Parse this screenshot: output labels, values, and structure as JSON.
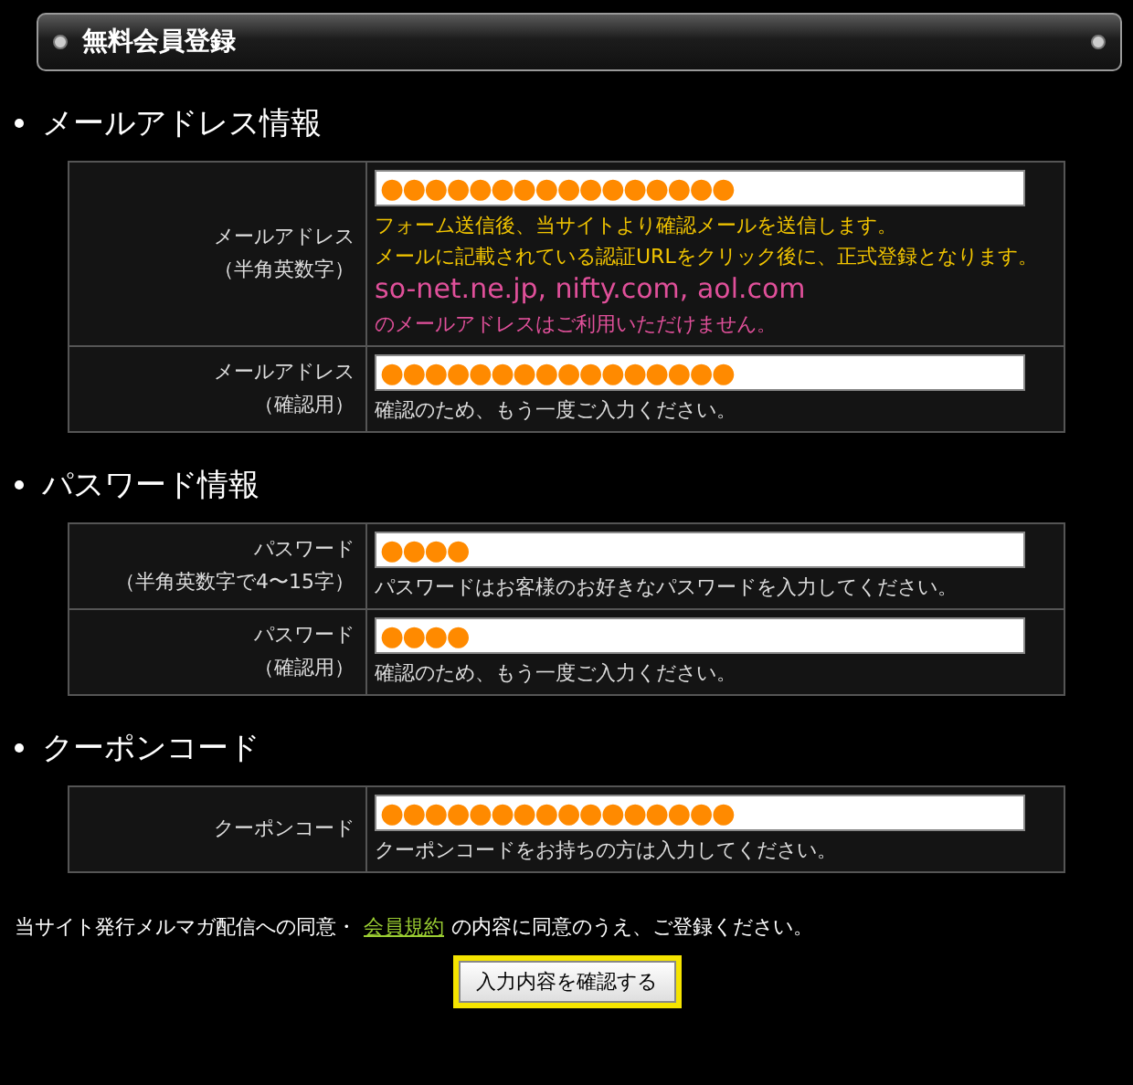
{
  "title": "無料会員登録",
  "sections": [
    {
      "heading": "メールアドレス情報",
      "rows": [
        {
          "label": "メールアドレス",
          "sublabel": "（半角英数字）",
          "value": "●●●●●●●●●●●●●●●●",
          "notes": [
            {
              "kind": "info",
              "text": "フォーム送信後、当サイトより確認メールを送信します。"
            },
            {
              "kind": "info",
              "text": "メールに記載されている認証URLをクリック後に、正式登録となります。"
            },
            {
              "kind": "warning-large",
              "text": "so-net.ne.jp, nifty.com, aol.com"
            },
            {
              "kind": "warning",
              "text": "のメールアドレスはご利用いただけません。"
            }
          ]
        },
        {
          "label": "メールアドレス",
          "sublabel": "（確認用）",
          "value": "●●●●●●●●●●●●●●●●",
          "notes": [
            {
              "kind": "plain",
              "text": "確認のため、もう一度ご入力ください。"
            }
          ]
        }
      ]
    },
    {
      "heading": "パスワード情報",
      "rows": [
        {
          "label": "パスワード",
          "sublabel": "（半角英数字で4〜15字）",
          "value": "●●●●",
          "notes": [
            {
              "kind": "plain",
              "text": "パスワードはお客様のお好きなパスワードを入力してください。"
            }
          ]
        },
        {
          "label": "パスワード",
          "sublabel": "（確認用）",
          "value": "●●●●",
          "notes": [
            {
              "kind": "plain",
              "text": "確認のため、もう一度ご入力ください。"
            }
          ]
        }
      ]
    },
    {
      "heading": "クーポンコード",
      "rows": [
        {
          "label": "クーポンコード",
          "value": "●●●●●●●●●●●●●●●●",
          "notes": [
            {
              "kind": "plain",
              "text": "クーポンコードをお持ちの方は入力してください。"
            }
          ]
        }
      ]
    }
  ],
  "agreement": {
    "before": "当サイト発行メルマガ配信への同意・",
    "link": "会員規約",
    "after": "の内容に同意のうえ、ご登録ください。"
  },
  "submit_button": "入力内容を確認する"
}
